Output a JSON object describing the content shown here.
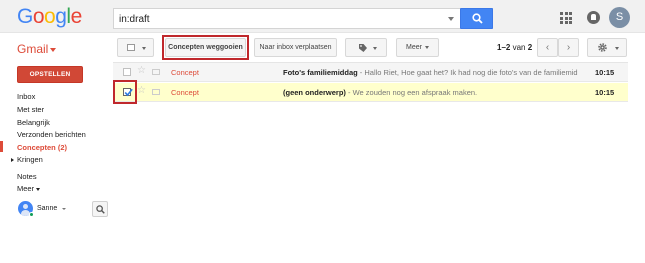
{
  "header": {
    "logo_letters": [
      {
        "char": "G",
        "color": "#4285f4"
      },
      {
        "char": "o",
        "color": "#ea4335"
      },
      {
        "char": "o",
        "color": "#fbbc05"
      },
      {
        "char": "g",
        "color": "#4285f4"
      },
      {
        "char": "l",
        "color": "#34a853"
      },
      {
        "char": "e",
        "color": "#ea4335"
      }
    ],
    "search_value": "in:draft",
    "search_icon": "search-icon",
    "apps_icon": "apps-grid-icon",
    "notifications_icon": "notifications-icon",
    "account_initial": "S"
  },
  "toolbar": {
    "app_label": "Gmail",
    "discard_label": "Concepten weggooien",
    "move_label": "Naar inbox verplaatsen",
    "labels_icon": "label-tag-icon",
    "more_label": "Meer",
    "pagination_range": "1–2",
    "pagination_of": "van",
    "pagination_total": "2",
    "prev_icon": "‹",
    "next_icon": "›",
    "settings_icon": "gear-icon"
  },
  "sidebar": {
    "compose_label": "OPSTELLEN",
    "items": [
      {
        "label": "Inbox",
        "active": false
      },
      {
        "label": "Met ster",
        "active": false
      },
      {
        "label": "Belangrijk",
        "active": false
      },
      {
        "label": "Verzonden berichten",
        "active": false
      },
      {
        "label": "Concepten (2)",
        "active": true
      },
      {
        "label": "Kringen",
        "active": false
      },
      {
        "label": "Notes",
        "active": false
      },
      {
        "label": "Meer",
        "active": false
      }
    ],
    "user_name": "Sanne"
  },
  "messages": [
    {
      "sender": "Concept",
      "subject": "Foto's familiemiddag",
      "snippet": " - Hallo Riet, Hoe gaat het? Ik had nog die foto's van de familiemid",
      "time": "10:15",
      "checked": false
    },
    {
      "sender": "Concept",
      "subject": "(geen onderwerp)",
      "snippet": " - We zouden nog een afspraak maken.",
      "time": "10:15",
      "checked": true
    }
  ],
  "colors": {
    "accent_red": "#dd4b39",
    "compose_red": "#d14836",
    "search_blue": "#4285f4",
    "selected_row": "#ffffcc",
    "annotation_red": "#c0282c"
  }
}
